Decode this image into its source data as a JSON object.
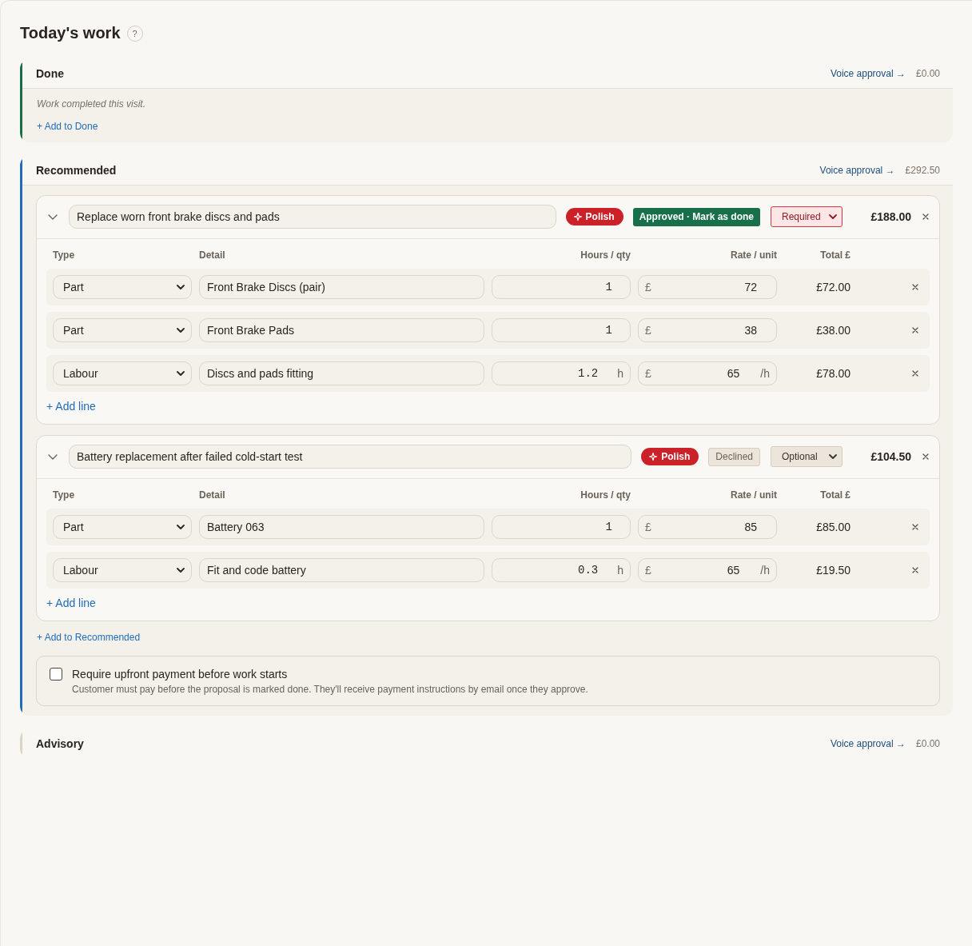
{
  "page": {
    "title": "Today's work",
    "help": "?"
  },
  "sections": [
    {
      "title": "Done",
      "color": "#1a6e45",
      "voice_link": "Voice approval →",
      "total": "£0.00",
      "note": "Work completed this visit.",
      "add_link": "+ Add to Done"
    },
    {
      "title": "Recommended",
      "color": "#1f6db8",
      "voice_link": "Voice approval →",
      "total": "£292.50",
      "jobs": [
        {
          "expanded": true,
          "title": "Replace worn front brake discs and pads",
          "polish": "Polish",
          "status": {
            "kind": "approved",
            "label": "Approved · Mark as done"
          },
          "priority": {
            "kind": "required",
            "label": "Required"
          },
          "total": "£188.00",
          "columns": [
            "Type",
            "Detail",
            "Hours / qty",
            "Rate / unit",
            "Total £"
          ],
          "lines": [
            {
              "type": "Part",
              "detail": "Front Brake Discs (pair)",
              "qty": "1",
              "currency": "£",
              "rate": "72",
              "total": "£72.00"
            },
            {
              "type": "Part",
              "detail": "Front Brake Pads",
              "qty": "1",
              "currency": "£",
              "rate": "38",
              "total": "£38.00"
            },
            {
              "type": "Labour",
              "detail": "Discs and pads fitting",
              "qty": "1.2",
              "qty_unit": "h",
              "currency": "£",
              "rate": "65",
              "rate_unit": "/h",
              "total": "£78.00"
            }
          ],
          "add_line": "+ Add line"
        },
        {
          "expanded": true,
          "title": "Battery replacement after failed cold-start test",
          "polish": "Polish",
          "status": {
            "kind": "declined",
            "label": "Declined"
          },
          "priority": {
            "kind": "optional",
            "label": "Optional"
          },
          "total": "£104.50",
          "columns": [
            "Type",
            "Detail",
            "Hours / qty",
            "Rate / unit",
            "Total £"
          ],
          "lines": [
            {
              "type": "Part",
              "detail": "Battery 063",
              "qty": "1",
              "currency": "£",
              "rate": "85",
              "total": "£85.00"
            },
            {
              "type": "Labour",
              "detail": "Fit and code battery",
              "qty": "0.3",
              "qty_unit": "h",
              "currency": "£",
              "rate": "65",
              "rate_unit": "/h",
              "total": "£19.50"
            }
          ],
          "add_line": "+ Add line"
        }
      ],
      "add_link": "+ Add to Recommended",
      "upfront": {
        "checked": false,
        "label": "Require upfront payment before work starts",
        "help": "Customer must pay before the proposal is marked done. They'll receive payment instructions by email once they approve."
      }
    },
    {
      "title": "Advisory",
      "color": "#ddd3c3",
      "voice_link": "Voice approval →",
      "total": "£0.00"
    }
  ]
}
